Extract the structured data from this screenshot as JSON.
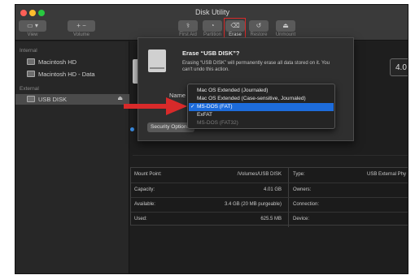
{
  "window": {
    "title": "Disk Utility"
  },
  "toolbar": {
    "view": "View",
    "volume": "Volume",
    "first_aid": "First Aid",
    "partition": "Partition",
    "erase": "Erase",
    "restore": "Restore",
    "unmount": "Unmount"
  },
  "sidebar": {
    "internal_header": "Internal",
    "external_header": "External",
    "items": [
      {
        "label": "Macintosh HD"
      },
      {
        "label": "Macintosh HD - Data"
      },
      {
        "label": "USB DISK"
      }
    ]
  },
  "main": {
    "capacity_badge": "4.0",
    "info": [
      {
        "label": "Mount Point:",
        "value": "/Volumes/USB DISK",
        "rlabel": "Type:",
        "rvalue": "USB External Phy"
      },
      {
        "label": "Capacity:",
        "value": "4.01 GB",
        "rlabel": "Owners:",
        "rvalue": ""
      },
      {
        "label": "Available:",
        "value": "3.4 GB (20 MB purgeable)",
        "rlabel": "Connection:",
        "rvalue": ""
      },
      {
        "label": "Used:",
        "value": "625.5 MB",
        "rlabel": "Device:",
        "rvalue": ""
      }
    ]
  },
  "dialog": {
    "title": "Erase “USB DISK”?",
    "description": "Erasing “USB DISK” will permanently erase all data stored on it. You can't undo this action.",
    "name_label": "Name",
    "security_button": "Security Options..."
  },
  "format_menu": {
    "options": [
      {
        "label": "Mac OS Extended (Journaled)",
        "selected": false,
        "disabled": false
      },
      {
        "label": "Mac OS Extended (Case-sensitive, Journaled)",
        "selected": false,
        "disabled": false
      },
      {
        "label": "MS-DOS (FAT)",
        "selected": true,
        "disabled": false
      },
      {
        "label": "ExFAT",
        "selected": false,
        "disabled": false
      },
      {
        "label": "MS-DOS (FAT32)",
        "selected": false,
        "disabled": true
      }
    ],
    "check_glyph": "✓"
  },
  "colors": {
    "selection": "#1d6cdb",
    "arrow": "#d82a2a",
    "close": "#ff5f57",
    "minimize": "#febc2e",
    "zoom": "#28c840"
  }
}
